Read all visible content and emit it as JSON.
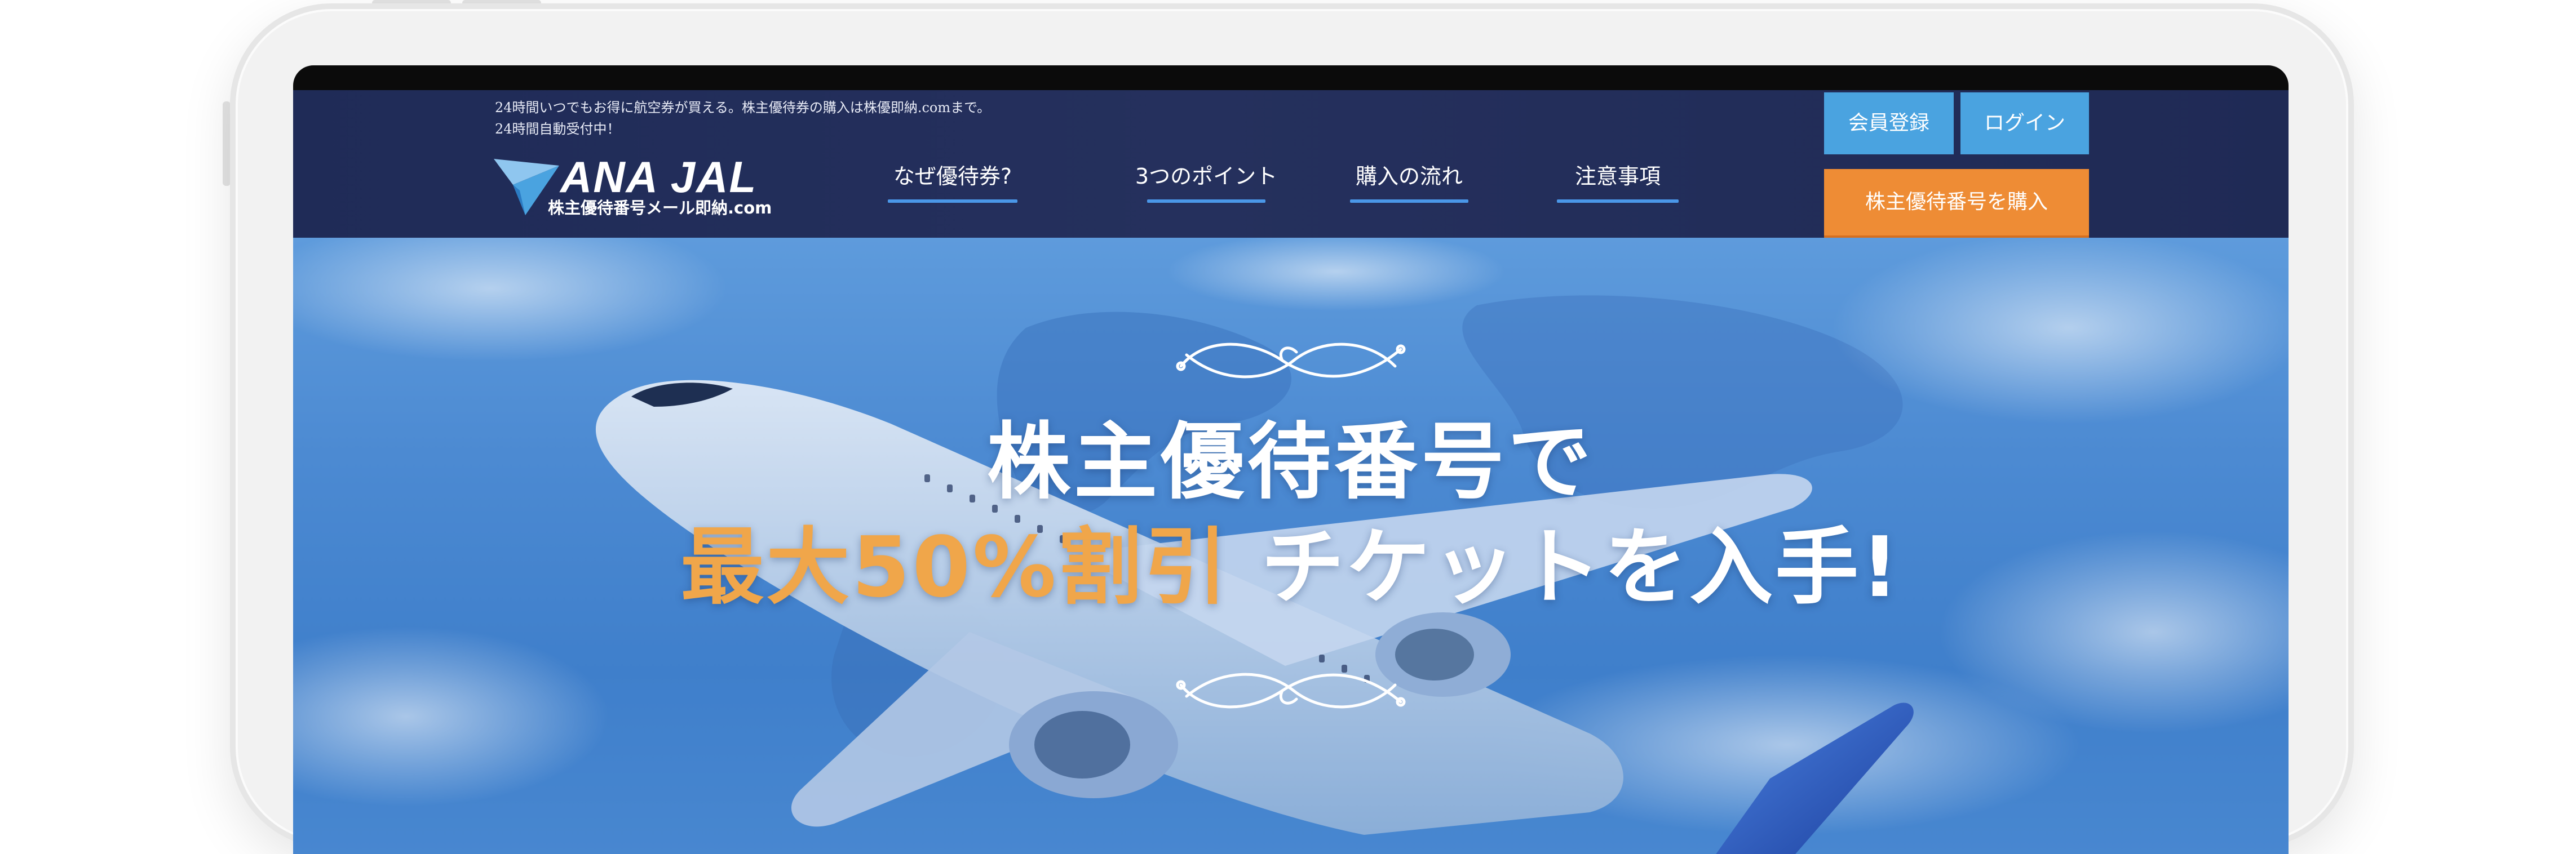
{
  "header": {
    "tagline_line1": "24時間いつでもお得に航空券が買える。株主優待券の購入は株優即納.comまで。",
    "tagline_line2": "24時間自動受付中！",
    "logo_main": "ANA JAL",
    "logo_sub": "株主優待番号メール即納.com"
  },
  "nav": {
    "items": [
      {
        "label": "なぜ優待券?"
      },
      {
        "label": "3つのポイント"
      },
      {
        "label": "購入の流れ"
      },
      {
        "label": "注意事項"
      }
    ]
  },
  "buttons": {
    "register": "会員登録",
    "login": "ログイン",
    "buy": "株主優待番号を購入"
  },
  "hero": {
    "line1": "株主優待番号で",
    "line2_highlight": "最大50%割引",
    "line2_rest": " チケットを入手!"
  },
  "colors": {
    "header_bg": "#1f2b57",
    "accent_blue": "#4aa3e0",
    "accent_orange": "#ee8c35",
    "highlight_text": "#f0a64a"
  }
}
